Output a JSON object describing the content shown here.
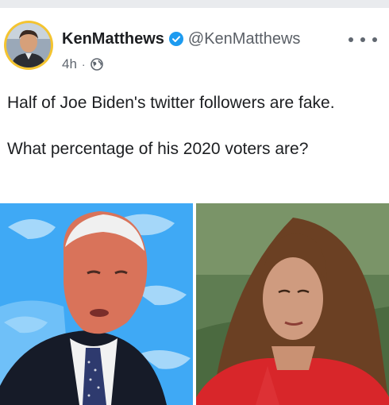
{
  "post": {
    "author_name": "KenMatthews",
    "handle": "@KenMatthews",
    "timestamp": "4h",
    "separator": "·",
    "privacy_icon": "globe-icon",
    "verified_icon": "verified-badge-icon",
    "more_icon": "more-options-icon",
    "text_paragraphs": [
      "Half of Joe Biden's twitter followers are fake.",
      "What percentage of his 2020 voters are?"
    ]
  },
  "media": {
    "images": [
      {
        "name": "photo-joe-biden-twitter-background"
      },
      {
        "name": "photo-woman-red-top"
      }
    ]
  },
  "colors": {
    "verified_blue": "#1d9bf0",
    "avatar_ring": "#f4c430",
    "twitter_blue": "#1da1f2"
  }
}
